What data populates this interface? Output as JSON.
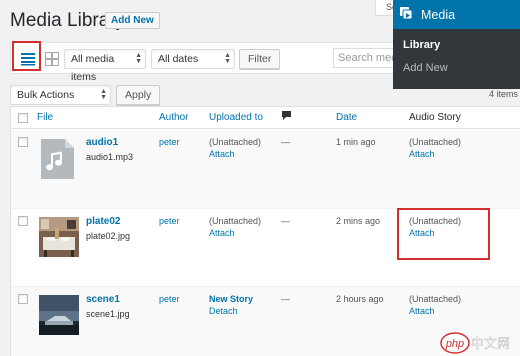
{
  "header": {
    "title": "Media Library",
    "add_new_label": "Add New",
    "screen_options_label": "Se"
  },
  "filters": {
    "media_type": "All media items",
    "dates": "All dates",
    "filter_button": "Filter",
    "search_placeholder": "Search media"
  },
  "bulk": {
    "action": "Bulk Actions",
    "apply_button": "Apply",
    "items_count": "4 items"
  },
  "table": {
    "columns": {
      "file": "File",
      "author": "Author",
      "uploaded_to": "Uploaded to",
      "date": "Date",
      "audio_story": "Audio Story"
    },
    "rows": [
      {
        "title": "audio1",
        "filename": "audio1.mp3",
        "author": "peter",
        "uploaded": "(Unattached)",
        "uploaded_link": "Attach",
        "comments": "—",
        "date": "1 min ago",
        "audio_story": "(Unattached)",
        "audio_link": "Attach"
      },
      {
        "title": "plate02",
        "filename": "plate02.jpg",
        "author": "peter",
        "uploaded": "(Unattached)",
        "uploaded_link": "Attach",
        "comments": "—",
        "date": "2 mins ago",
        "audio_story": "(Unattached)",
        "audio_link": "Attach"
      },
      {
        "title": "scene1",
        "filename": "scene1.jpg",
        "author": "peter",
        "uploaded": "New Story",
        "uploaded_link": "Detach",
        "comments": "—",
        "date": "2 hours ago",
        "audio_story": "(Unattached)",
        "audio_link": "Attach"
      }
    ]
  },
  "admin_menu": {
    "title": "Media",
    "items": [
      "Library",
      "Add New"
    ]
  },
  "colors": {
    "link": "#0073aa",
    "highlight": "#d32f2f",
    "menu_bg": "#32373c",
    "menu_head": "#0073aa"
  },
  "watermark": "php中文网"
}
